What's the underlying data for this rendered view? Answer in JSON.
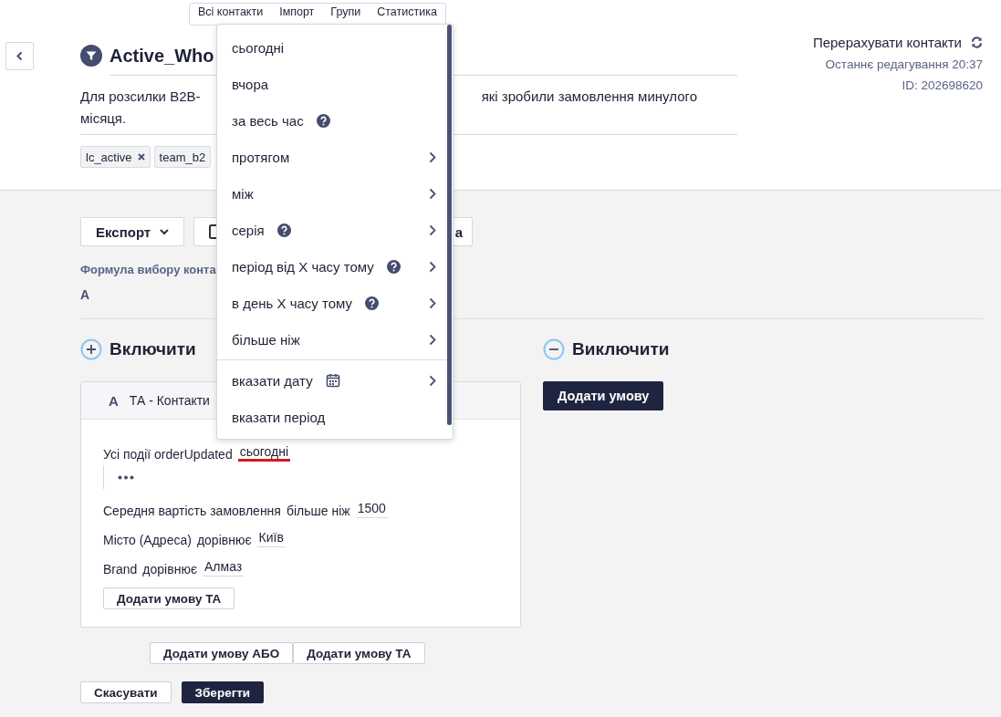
{
  "tabs": [
    {
      "label": "Всі контакти"
    },
    {
      "label": "Імпорт"
    },
    {
      "label": "Групи"
    },
    {
      "label": "Статистика"
    }
  ],
  "segment": {
    "title": "Active_Who",
    "description": {
      "line_1_start": "Для розсилки B2B-",
      "line_1_end": "які зробили замовлення минулого",
      "line_2": "місяця."
    },
    "tags": [
      {
        "label": "lc_active",
        "removable": true
      },
      {
        "label": "team_b2",
        "removable": false
      }
    ]
  },
  "recount": {
    "label": "Перерахувати контакти"
  },
  "last_edited": "Останнє редагування 20:37",
  "id": "ID: 202698620",
  "toolbar": [
    {
      "kind": "dropdown",
      "label": "Експорт"
    },
    {
      "kind": "icon-button",
      "label": "а"
    }
  ],
  "formula": {
    "label": "Формула вибору конта",
    "value": "A"
  },
  "include": {
    "title": "Включити",
    "group": {
      "letter": "A",
      "title": "ТА - Контакти",
      "conditions": [
        {
          "kind": "event",
          "text": "Усі події orderUpdated",
          "value": "сьогодні",
          "highlighted": true
        },
        {
          "kind": "ellipsis"
        },
        {
          "kind": "filter",
          "field": "Середня вартість замовлення",
          "operator": "більше ніж",
          "value": "1500"
        },
        {
          "kind": "filter",
          "field": "Місто (Адреса)",
          "operator": "дорівнює",
          "value": "Київ"
        },
        {
          "kind": "filter",
          "field": "Brand",
          "operator": "дорівнює",
          "value": "Алмаз"
        }
      ],
      "add_button": "Додати умову ТА"
    },
    "add_or": "Додати умову АБО",
    "add_and": "Додати умову ТА"
  },
  "exclude": {
    "title": "Виключити",
    "add_button": "Додати умову"
  },
  "actions": {
    "cancel": "Скасувати",
    "save": "Зберегти"
  },
  "date_menu": {
    "items": [
      {
        "label": "сьогодні",
        "help": false,
        "submenu": false,
        "calendar": false,
        "divider_before": false
      },
      {
        "label": "вчора",
        "help": false,
        "submenu": false,
        "calendar": false,
        "divider_before": false
      },
      {
        "label": "за весь час",
        "help": true,
        "submenu": false,
        "calendar": false,
        "divider_before": false
      },
      {
        "label": "протягом",
        "help": false,
        "submenu": true,
        "calendar": false,
        "divider_before": false
      },
      {
        "label": "між",
        "help": false,
        "submenu": true,
        "calendar": false,
        "divider_before": false
      },
      {
        "label": "серія",
        "help": true,
        "submenu": true,
        "calendar": false,
        "divider_before": false
      },
      {
        "label": "період від X часу тому",
        "help": true,
        "submenu": true,
        "calendar": false,
        "divider_before": false
      },
      {
        "label": "в день X часу тому",
        "help": true,
        "submenu": true,
        "calendar": false,
        "divider_before": false
      },
      {
        "label": "більше ніж",
        "help": false,
        "submenu": true,
        "calendar": false,
        "divider_before": false
      },
      {
        "label": "вказати дату",
        "help": false,
        "submenu": true,
        "calendar": true,
        "divider_before": true
      },
      {
        "label": "вказати період",
        "help": false,
        "submenu": false,
        "calendar": false,
        "divider_before": false
      }
    ]
  }
}
